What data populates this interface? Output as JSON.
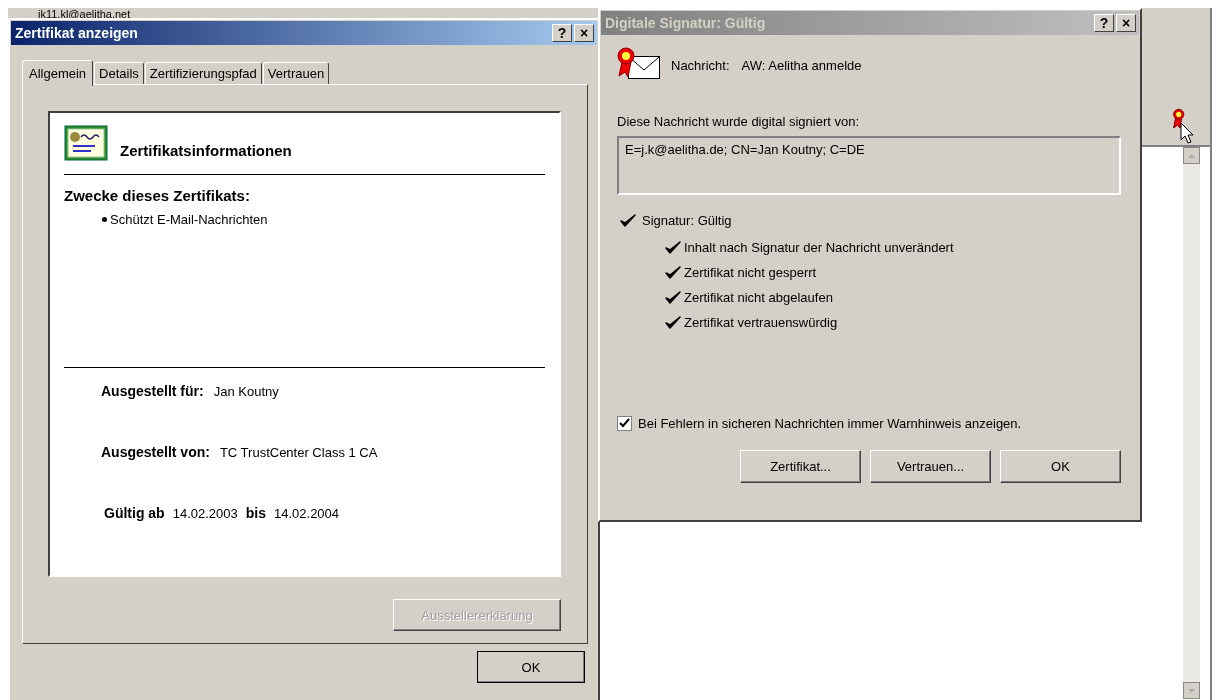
{
  "background_window": {
    "address_text": "jk11.kl@aelitha.net"
  },
  "certificate_dialog": {
    "title": "Zertifikat anzeigen",
    "active": true,
    "title_buttons": [
      "?",
      "×"
    ],
    "tabs": [
      {
        "label": "Allgemein",
        "selected": true
      },
      {
        "label": "Details",
        "selected": false
      },
      {
        "label": "Zertifizierungspfad",
        "selected": false
      },
      {
        "label": "Vertrauen",
        "selected": false
      }
    ],
    "heading": "Zertifikatsinformationen",
    "purposes_heading": "Zwecke dieses Zertifikats:",
    "purposes": [
      "Schützt E-Mail-Nachrichten"
    ],
    "issued_to_label": "Ausgestellt für:",
    "issued_to": "Jan Koutny",
    "issued_by_label": "Ausgestellt von:",
    "issued_by": "TC TrustCenter Class 1 CA",
    "valid_from_label": "Gültig ab",
    "valid_from": "14.02.2003",
    "valid_to_label": "bis",
    "valid_to": "14.02.2004",
    "panel_button": {
      "label": "Ausstellererklärung",
      "disabled": true
    },
    "buttons": [
      {
        "label": "OK",
        "disabled": false
      }
    ]
  },
  "signature_dialog": {
    "title": "Digitale Signatur: Gültig",
    "active": false,
    "title_buttons": [
      "?",
      "×"
    ],
    "message_label": "Nachricht:",
    "message_subject": "AW: Aelitha anmelde",
    "signed_by_label": "Diese Nachricht wurde digital signiert von:",
    "signer": "E=j.k@aelitha.de; CN=Jan Koutny; C=DE",
    "status": {
      "label": "Signatur: Gültig",
      "ok": true
    },
    "checks": [
      {
        "label": "Inhalt nach Signatur der Nachricht unverändert",
        "ok": true
      },
      {
        "label": "Zertifikat nicht gesperrt",
        "ok": true
      },
      {
        "label": "Zertifikat nicht abgelaufen",
        "ok": true
      },
      {
        "label": "Zertifikat vertrauenswürdig",
        "ok": true
      }
    ],
    "warning_checkbox": {
      "label": "Bei Fehlern in sicheren Nachrichten immer Warnhinweis anzeigen.",
      "checked": true
    },
    "buttons": [
      {
        "label": "Zertifikat...",
        "disabled": false
      },
      {
        "label": "Vertrauen...",
        "disabled": false
      },
      {
        "label": "OK",
        "disabled": false
      }
    ]
  }
}
